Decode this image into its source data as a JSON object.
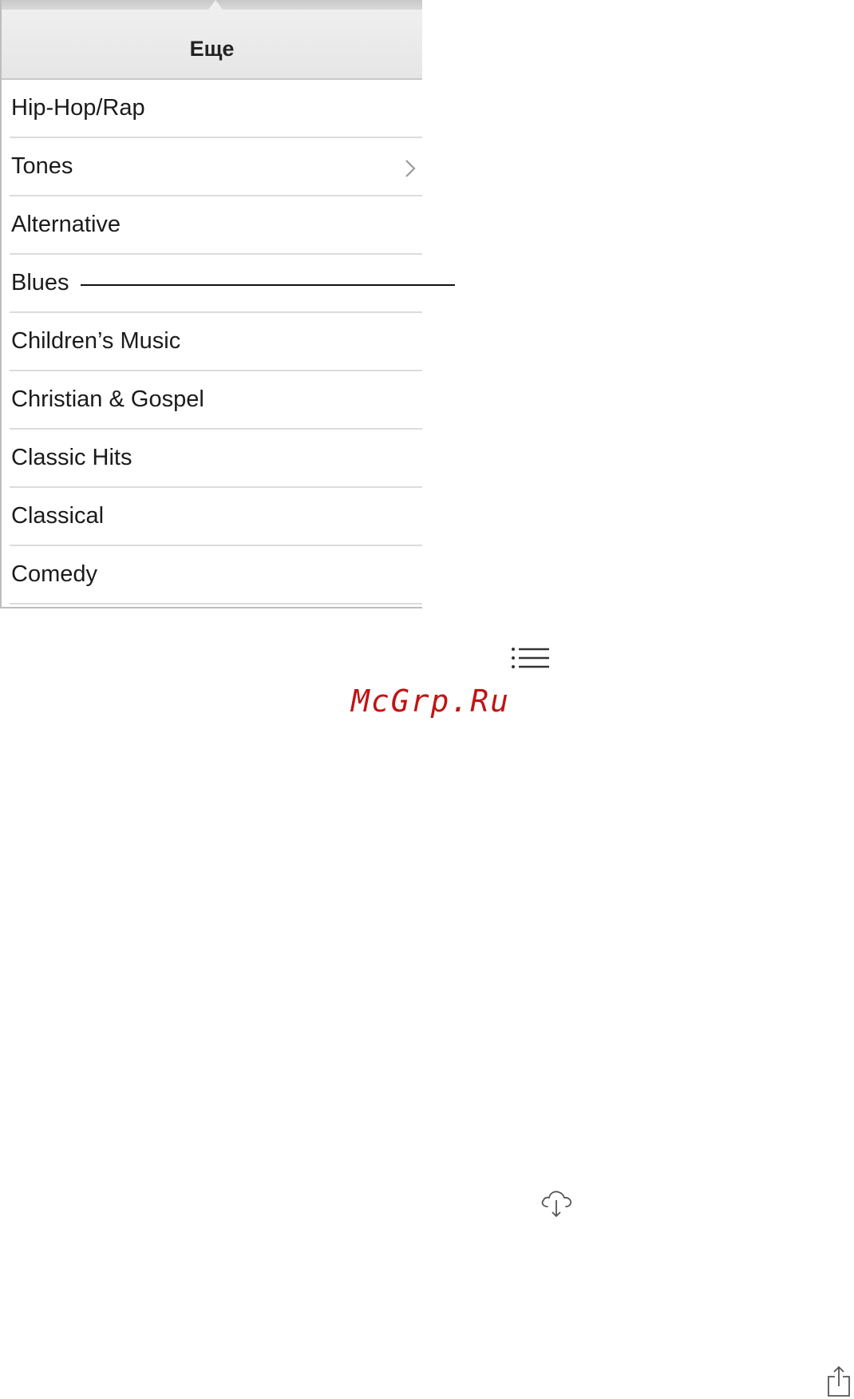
{
  "popover": {
    "title": "Еще",
    "items": [
      {
        "label": "Hip-Hop/Rap"
      },
      {
        "label": "Tones",
        "has_chevron": true
      },
      {
        "label": "Alternative"
      },
      {
        "label": "Blues"
      },
      {
        "label": "Children’s Music"
      },
      {
        "label": "Christian & Gospel"
      },
      {
        "label": "Classic Hits"
      },
      {
        "label": "Classical"
      },
      {
        "label": "Comedy"
      }
    ]
  },
  "icons": {
    "list": "list-icon",
    "cloud_download": "cloud-download-icon",
    "share": "share-icon",
    "chevron": "chevron-right-icon"
  },
  "watermark": {
    "text": "McGrp.Ru",
    "color": "#c01414"
  }
}
